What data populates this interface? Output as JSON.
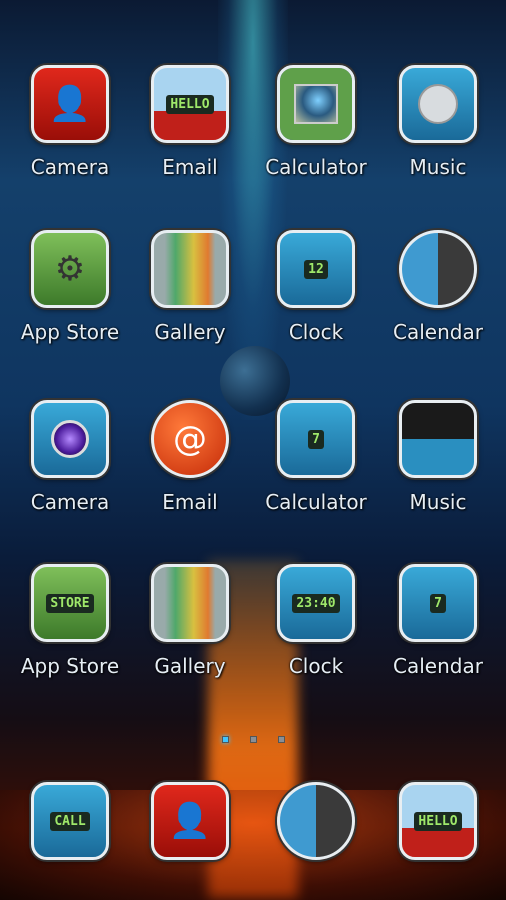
{
  "apps": [
    {
      "label": "Camera",
      "icon": "red-robot-person-icon",
      "glyph": "👤"
    },
    {
      "label": "Email",
      "icon": "hello-robot-icon",
      "screen": "HELLO"
    },
    {
      "label": "Calculator",
      "icon": "green-monitor-icon"
    },
    {
      "label": "Music",
      "icon": "blue-disc-robot-icon"
    },
    {
      "label": "App Store",
      "icon": "gears-icon",
      "glyph": "⚙"
    },
    {
      "label": "Gallery",
      "icon": "rainbow-panel-icon"
    },
    {
      "label": "Clock",
      "icon": "blue-keypad-icon",
      "screen": "12"
    },
    {
      "label": "Calendar",
      "icon": "mechanical-earth-icon"
    },
    {
      "label": "Camera",
      "icon": "purple-lens-robot-icon"
    },
    {
      "label": "Email",
      "icon": "orange-at-sphere-icon",
      "glyph": "@"
    },
    {
      "label": "Calculator",
      "icon": "blue-robot-7-icon",
      "screen": "7"
    },
    {
      "label": "Music",
      "icon": "black-dome-robot-icon"
    },
    {
      "label": "App Store",
      "icon": "green-store-crate-icon",
      "screen": "STORE"
    },
    {
      "label": "Gallery",
      "icon": "rainbow-panel-icon"
    },
    {
      "label": "Clock",
      "icon": "digital-clock-robot-icon",
      "screen": "23:40"
    },
    {
      "label": "Calendar",
      "icon": "blue-robot-7-icon",
      "screen": "7"
    }
  ],
  "dock": [
    {
      "icon": "call-phone-icon",
      "screen": "CALL"
    },
    {
      "icon": "red-robot-person-icon",
      "glyph": "👤"
    },
    {
      "icon": "mechanical-earth-icon"
    },
    {
      "icon": "hello-robot-icon",
      "screen": "HELLO"
    }
  ],
  "pager": {
    "pages": 3,
    "current": 1
  },
  "colors": {
    "active_dot": "#3fc4ff",
    "label": "#e6eef5"
  }
}
